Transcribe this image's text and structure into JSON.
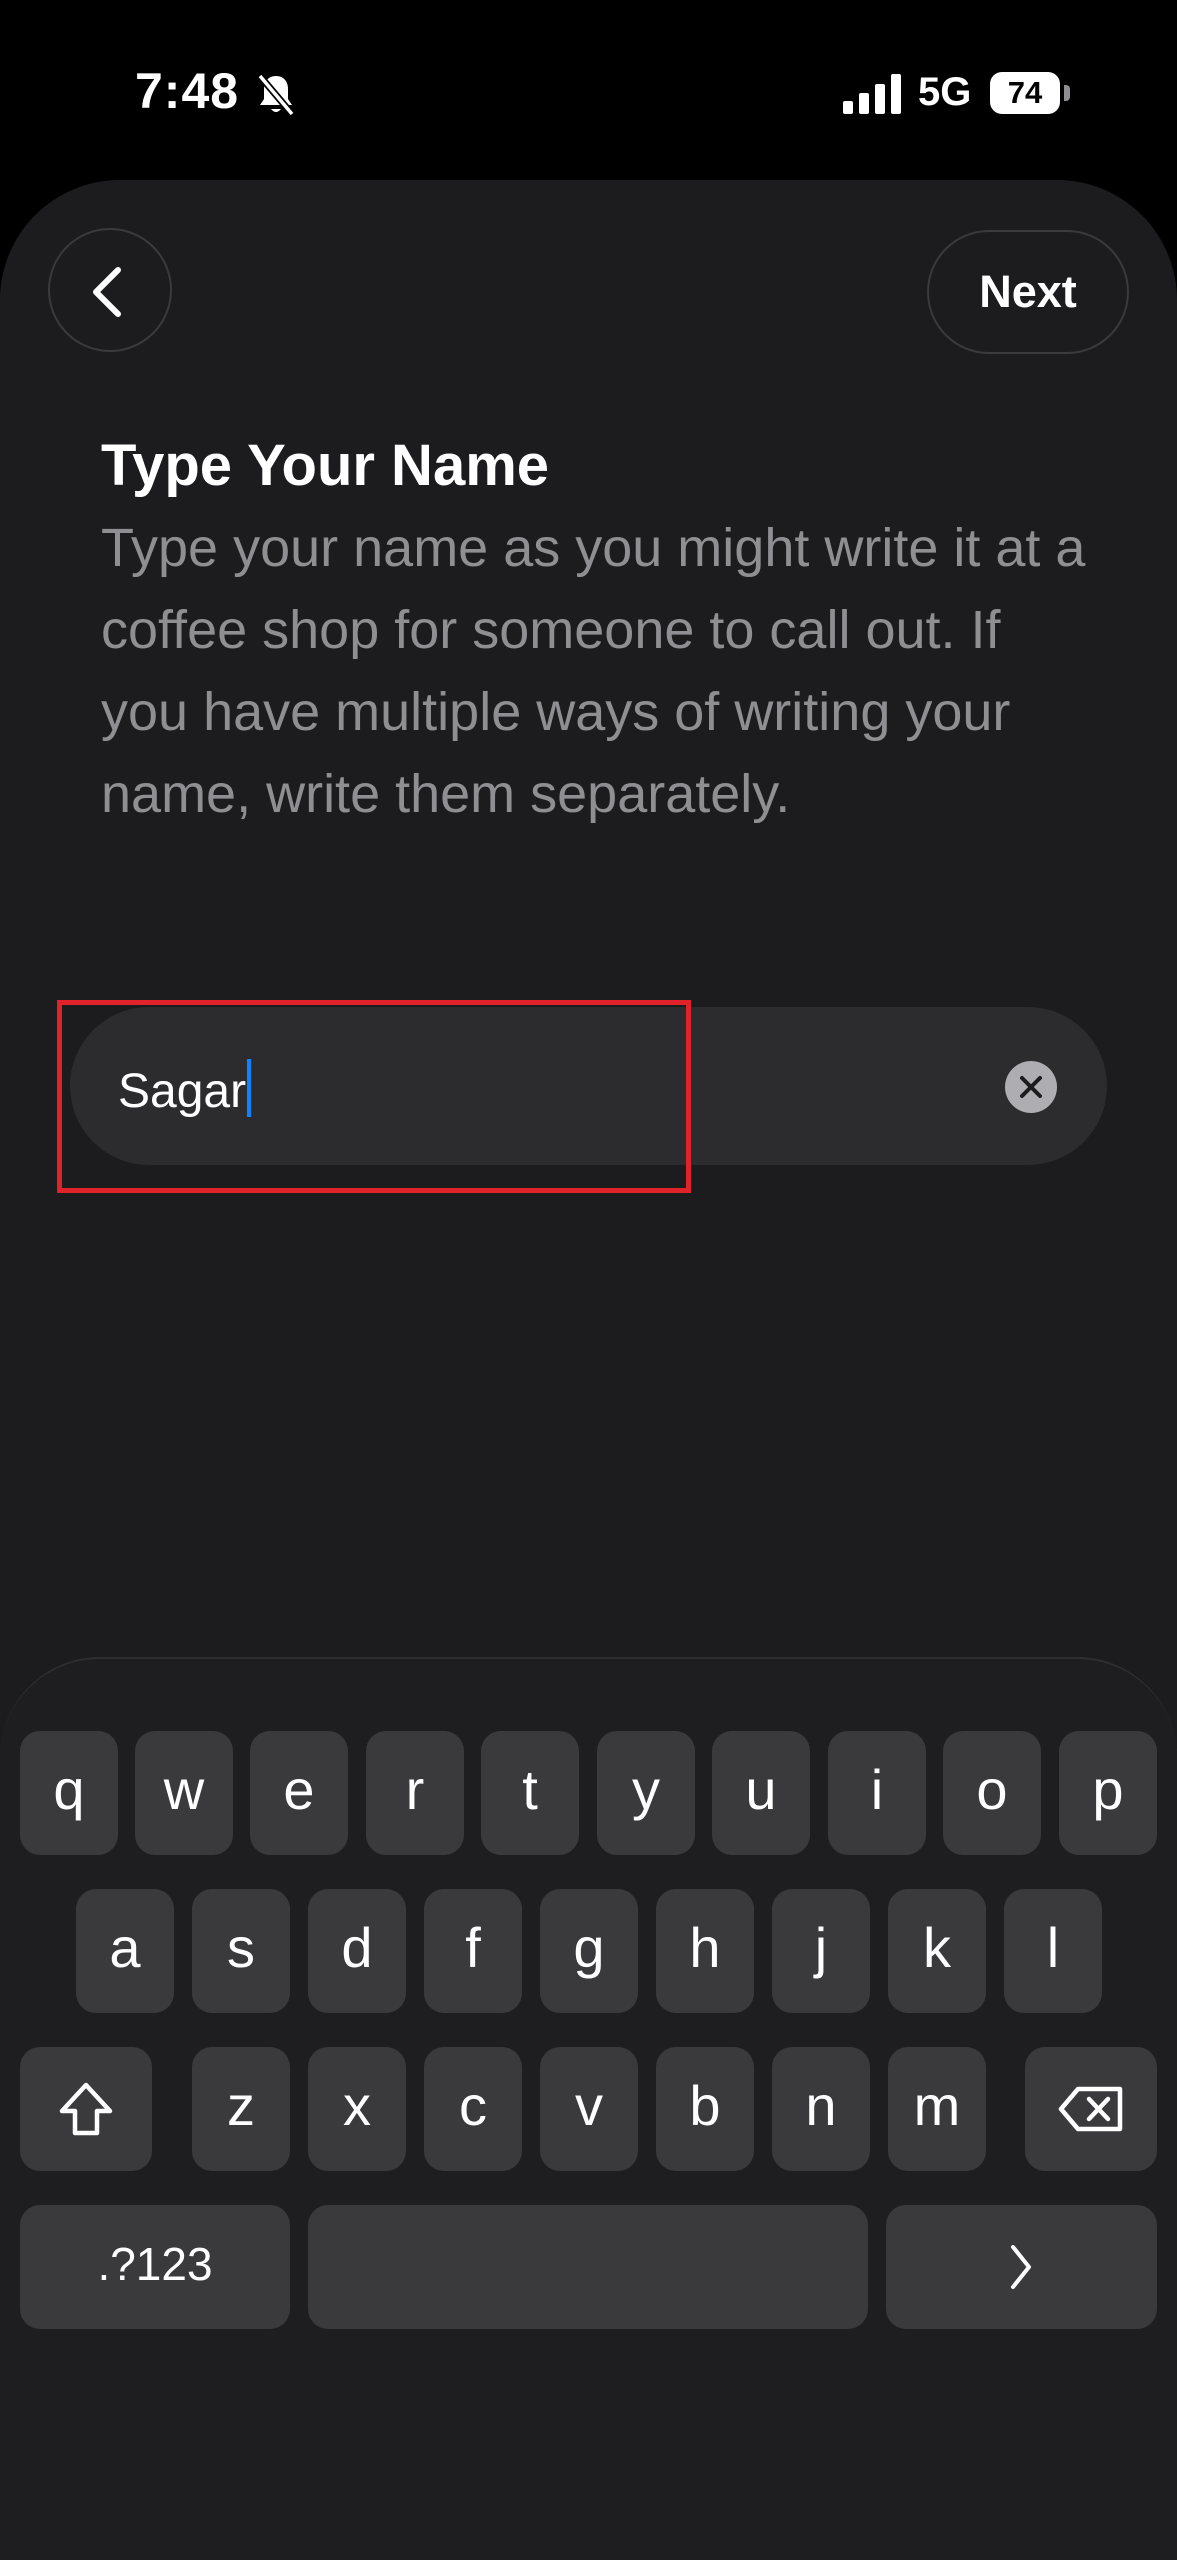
{
  "status_bar": {
    "time": "7:48",
    "network": "5G",
    "battery": "74",
    "icons": [
      "bell-slash-icon",
      "cellular-signal-icon",
      "battery-icon"
    ]
  },
  "nav": {
    "back_icon": "chevron-left-icon",
    "next_label": "Next"
  },
  "content": {
    "title": "Type Your Name",
    "description": "Type your name as you might write it at a coffee shop for someone to call out. If you have multiple ways of writing your name, write them separately."
  },
  "name_field": {
    "value": "Sagar",
    "clear_icon": "clear-x-icon",
    "caret_color": "#0a84ff"
  },
  "highlight": {
    "color": "#e0222b"
  },
  "keyboard": {
    "row1": [
      "q",
      "w",
      "e",
      "r",
      "t",
      "y",
      "u",
      "i",
      "o",
      "p"
    ],
    "row2": [
      "a",
      "s",
      "d",
      "f",
      "g",
      "h",
      "j",
      "k",
      "l"
    ],
    "row3": [
      "z",
      "x",
      "c",
      "v",
      "b",
      "n",
      "m"
    ],
    "shift_icon": "shift-arrow-icon",
    "delete_icon": "backspace-icon",
    "numbers_label": ".?123",
    "go_icon": "chevron-right-icon"
  }
}
